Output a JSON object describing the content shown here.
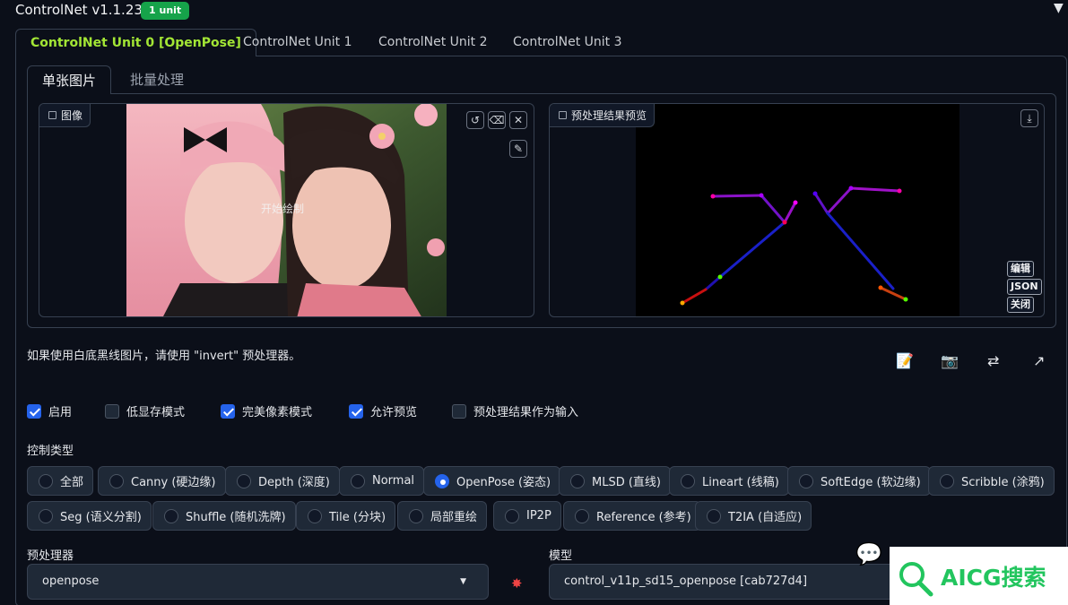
{
  "header": {
    "title": "ControlNet v1.1.238",
    "badge": "1 unit",
    "collapse_icon": "triangle-down-icon"
  },
  "unit_tabs": [
    {
      "label": "ControlNet Unit 0 [OpenPose]",
      "active": true
    },
    {
      "label": "ControlNet Unit 1",
      "active": false
    },
    {
      "label": "ControlNet Unit 2",
      "active": false
    },
    {
      "label": "ControlNet Unit 3",
      "active": false
    }
  ],
  "sub_tabs": [
    {
      "label": "单张图片",
      "active": true
    },
    {
      "label": "批量处理",
      "active": false
    }
  ],
  "image_box": {
    "label": "图像",
    "overlay_text": "开始绘制"
  },
  "preview_box": {
    "label": "预处理结果预览",
    "buttons": [
      "编辑",
      "JSON",
      "关闭"
    ]
  },
  "hint": "如果使用白底黑线图片，请使用 \"invert\" 预处理器。",
  "checkboxes": [
    {
      "label": "启用",
      "checked": true
    },
    {
      "label": "低显存模式",
      "checked": false
    },
    {
      "label": "完美像素模式",
      "checked": true
    },
    {
      "label": "允许预览",
      "checked": true
    },
    {
      "label": "预处理结果作为输入",
      "checked": false
    }
  ],
  "control_type": {
    "label": "控制类型",
    "options": [
      {
        "label": "全部",
        "selected": false
      },
      {
        "label": "Canny (硬边缘)",
        "selected": false
      },
      {
        "label": "Depth (深度)",
        "selected": false
      },
      {
        "label": "Normal",
        "selected": false
      },
      {
        "label": "OpenPose (姿态)",
        "selected": true
      },
      {
        "label": "MLSD (直线)",
        "selected": false
      },
      {
        "label": "Lineart (线稿)",
        "selected": false
      },
      {
        "label": "SoftEdge (软边缘)",
        "selected": false
      },
      {
        "label": "Scribble (涂鸦)",
        "selected": false
      },
      {
        "label": "Seg (语义分割)",
        "selected": false
      },
      {
        "label": "Shuffle (随机洗牌)",
        "selected": false
      },
      {
        "label": "Tile (分块)",
        "selected": false
      },
      {
        "label": "局部重绘",
        "selected": false
      },
      {
        "label": "IP2P",
        "selected": false
      },
      {
        "label": "Reference (参考)",
        "selected": false
      },
      {
        "label": "T2IA (自适应)",
        "selected": false
      }
    ]
  },
  "preprocessor": {
    "label": "预处理器",
    "value": "openpose"
  },
  "model": {
    "label": "模型",
    "value": "control_v11p_sd15_openpose [cab727d4]"
  },
  "watermark": {
    "text": "AICG搜索"
  },
  "colors": {
    "accent": "#a3e635",
    "badge": "#16a34a",
    "checked": "#2563eb",
    "bg": "#0b0f19"
  }
}
